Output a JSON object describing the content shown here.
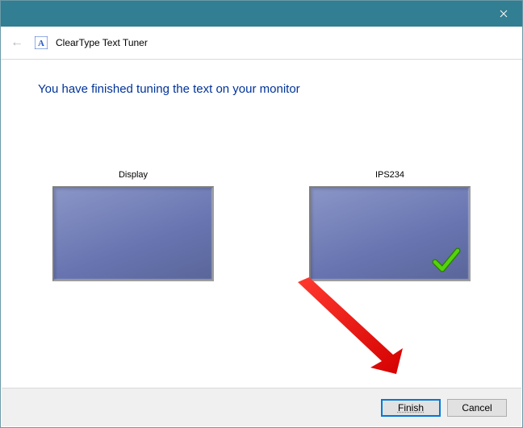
{
  "window": {
    "title": "ClearType Text Tuner"
  },
  "heading": "You have finished tuning the text on your monitor",
  "monitors": [
    {
      "label": "Display",
      "checked": false
    },
    {
      "label": "IPS234",
      "checked": true
    }
  ],
  "buttons": {
    "finish": "Finish",
    "cancel": "Cancel"
  }
}
